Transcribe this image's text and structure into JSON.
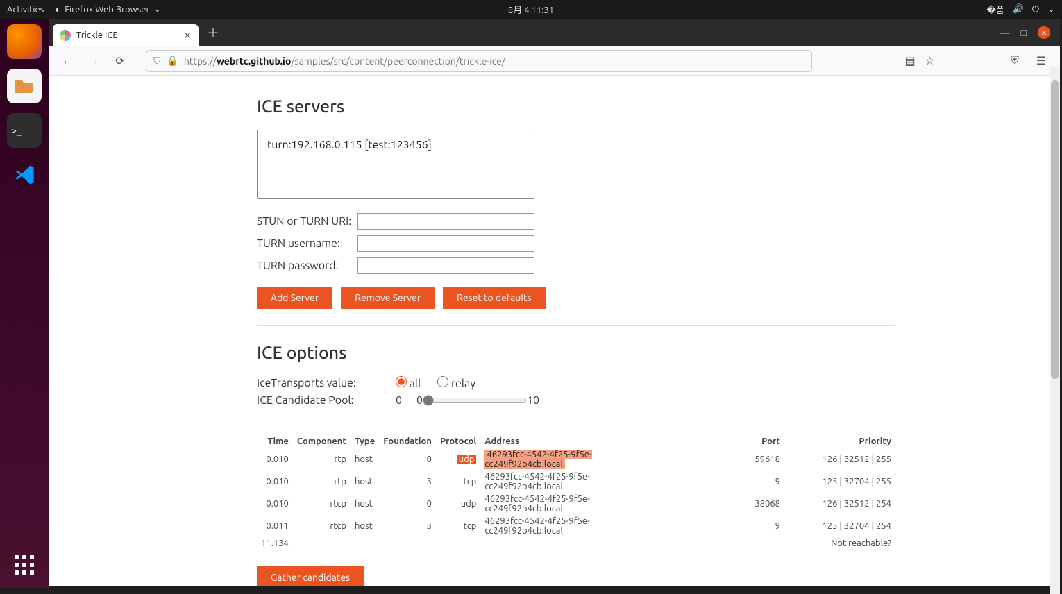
{
  "topbar": {
    "activities": "Activities",
    "app": "Firefox Web Browser",
    "datetime": "8月 4  11:31"
  },
  "tab": {
    "title": "Trickle ICE"
  },
  "url": {
    "scheme": "https://",
    "host": "webrtc.github.io",
    "path": "/samples/src/content/peerconnection/trickle-ice/"
  },
  "headings": {
    "servers": "ICE servers",
    "options": "ICE options"
  },
  "servers": {
    "item0": "turn:192.168.0.115 [test:123456]"
  },
  "labels": {
    "uri": "STUN or TURN URI:",
    "user": "TURN username:",
    "pass": "TURN password:",
    "transports": "IceTransports value:",
    "pool": "ICE Candidate Pool:",
    "radio_all": "all",
    "radio_relay": "relay"
  },
  "buttons": {
    "add": "Add Server",
    "remove": "Remove Server",
    "reset": "Reset to defaults",
    "gather": "Gather candidates"
  },
  "pool": {
    "value": "0",
    "min": "0",
    "max": "10"
  },
  "table": {
    "headers": {
      "time": "Time",
      "component": "Component",
      "type": "Type",
      "foundation": "Foundation",
      "protocol": "Protocol",
      "address": "Address",
      "port": "Port",
      "priority": "Priority"
    },
    "rows": [
      {
        "time": "0.010",
        "component": "rtp",
        "type": "host",
        "foundation": "0",
        "protocol": "udp",
        "address": "46293fcc-4542-4f25-9f5e-cc249f92b4cb.local",
        "port": "59618",
        "priority": "126 | 32512 | 255",
        "hl": true
      },
      {
        "time": "0.010",
        "component": "rtp",
        "type": "host",
        "foundation": "3",
        "protocol": "tcp",
        "address": "46293fcc-4542-4f25-9f5e-cc249f92b4cb.local",
        "port": "9",
        "priority": "125 | 32704 | 255"
      },
      {
        "time": "0.010",
        "component": "rtcp",
        "type": "host",
        "foundation": "0",
        "protocol": "udp",
        "address": "46293fcc-4542-4f25-9f5e-cc249f92b4cb.local",
        "port": "38068",
        "priority": "126 | 32512 | 254"
      },
      {
        "time": "0.011",
        "component": "rtcp",
        "type": "host",
        "foundation": "3",
        "protocol": "tcp",
        "address": "46293fcc-4542-4f25-9f5e-cc249f92b4cb.local",
        "port": "9",
        "priority": "125 | 32704 | 254"
      },
      {
        "time": "11.134",
        "component": "",
        "type": "",
        "foundation": "",
        "protocol": "",
        "address": "",
        "port": "",
        "priority": "Not reachable?"
      }
    ]
  }
}
